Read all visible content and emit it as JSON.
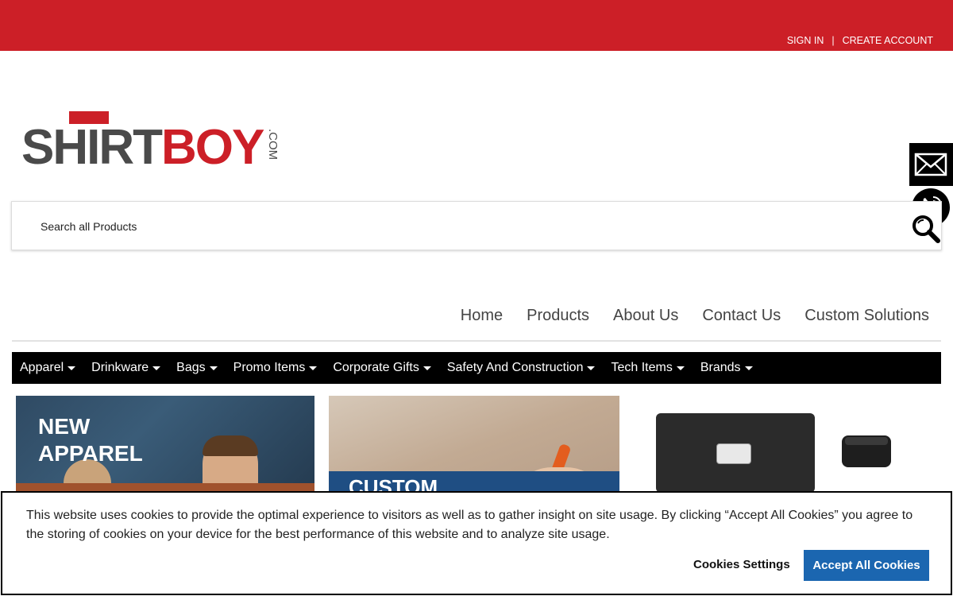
{
  "header": {
    "sign_in": "SIGN IN",
    "separator": "|",
    "create_account": "CREATE ACCOUNT",
    "brand_color": "#cc1f27"
  },
  "logo": {
    "text_primary": "SHIRTBOY",
    "text_suffix": ".COM"
  },
  "search": {
    "placeholder": "Search all Products"
  },
  "main_nav": [
    {
      "label": "Home"
    },
    {
      "label": "Products"
    },
    {
      "label": "About Us"
    },
    {
      "label": "Contact Us"
    },
    {
      "label": "Custom Solutions"
    }
  ],
  "categories": [
    {
      "label": "Apparel"
    },
    {
      "label": "Drinkware"
    },
    {
      "label": "Bags"
    },
    {
      "label": "Promo Items"
    },
    {
      "label": "Corporate Gifts"
    },
    {
      "label": "Safety And Construction"
    },
    {
      "label": "Tech Items"
    },
    {
      "label": "Brands"
    }
  ],
  "banners": {
    "new_apparel_line1": "NEW",
    "new_apparel_line2": "APPAREL",
    "custom_title": "CUSTOM"
  },
  "cookie_banner": {
    "message": "This website uses cookies to provide the optimal experience to visitors as well as to gather insight on site usage. By clicking “Accept All Cookies” you agree to the storing of cookies on your device for the best performance of this website and to analyze site usage.",
    "settings_label": "Cookies Settings",
    "accept_label": "Accept All Cookies",
    "accept_color": "#1b66b0"
  }
}
